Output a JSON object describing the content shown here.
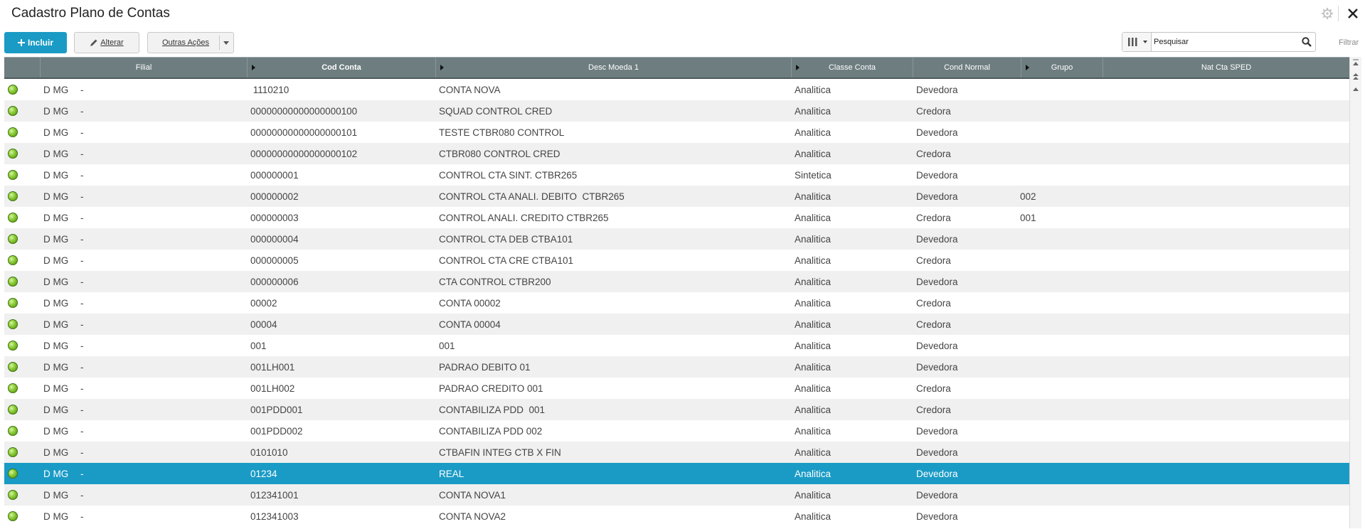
{
  "window": {
    "title": "Cadastro Plano de Contas"
  },
  "toolbar": {
    "incluir_label": "Incluir",
    "alterar_label": "Alterar",
    "outras_label": "Outras Ações"
  },
  "search": {
    "placeholder": "Pesquisar",
    "filter_label": "Filtrar"
  },
  "icons": {
    "gear": "gear-icon",
    "close": "close-icon",
    "plus": "plus-icon",
    "pencil": "pencil-icon",
    "columns": "columns-icon",
    "search": "search-icon",
    "status": "status-dot-icon"
  },
  "colors": {
    "accent": "#1a9bc5",
    "header": "#6e7d80",
    "status_green": "#88c934"
  },
  "grid": {
    "headers": [
      "Filial",
      "Cod Conta",
      "Desc Moeda 1",
      "Classe Conta",
      "Cond Normal",
      "Grupo",
      "Nat Cta SPED"
    ],
    "selected_row": 18,
    "rows": [
      {
        "filial": "D MG",
        "sep": "-",
        "cod": " 1110210",
        "desc": "CONTA NOVA",
        "classe": "Analitica",
        "cond": "Devedora",
        "grupo": "",
        "nat": ""
      },
      {
        "filial": "D MG",
        "sep": "-",
        "cod": "00000000000000000100",
        "desc": "SQUAD CONTROL CRED",
        "classe": "Analitica",
        "cond": "Credora",
        "grupo": "",
        "nat": ""
      },
      {
        "filial": "D MG",
        "sep": "-",
        "cod": "00000000000000000101",
        "desc": "TESTE CTBR080 CONTROL",
        "classe": "Analitica",
        "cond": "Devedora",
        "grupo": "",
        "nat": ""
      },
      {
        "filial": "D MG",
        "sep": "-",
        "cod": "00000000000000000102",
        "desc": "CTBR080 CONTROL CRED",
        "classe": "Analitica",
        "cond": "Credora",
        "grupo": "",
        "nat": ""
      },
      {
        "filial": "D MG",
        "sep": "-",
        "cod": "000000001",
        "desc": "CONTROL CTA SINT. CTBR265",
        "classe": "Sintetica",
        "cond": "Devedora",
        "grupo": "",
        "nat": ""
      },
      {
        "filial": "D MG",
        "sep": "-",
        "cod": "000000002",
        "desc": "CONTROL CTA ANALI. DEBITO  CTBR265",
        "classe": "Analitica",
        "cond": "Devedora",
        "grupo": "002",
        "nat": ""
      },
      {
        "filial": "D MG",
        "sep": "-",
        "cod": "000000003",
        "desc": "CONTROL ANALI. CREDITO CTBR265",
        "classe": "Analitica",
        "cond": "Credora",
        "grupo": "001",
        "nat": ""
      },
      {
        "filial": "D MG",
        "sep": "-",
        "cod": "000000004",
        "desc": "CONTROL CTA DEB CTBA101",
        "classe": "Analitica",
        "cond": "Devedora",
        "grupo": "",
        "nat": ""
      },
      {
        "filial": "D MG",
        "sep": "-",
        "cod": "000000005",
        "desc": "CONTROL CTA CRE CTBA101",
        "classe": "Analitica",
        "cond": "Credora",
        "grupo": "",
        "nat": ""
      },
      {
        "filial": "D MG",
        "sep": "-",
        "cod": "000000006",
        "desc": "CTA CONTROL CTBR200",
        "classe": "Analitica",
        "cond": "Devedora",
        "grupo": "",
        "nat": ""
      },
      {
        "filial": "D MG",
        "sep": "-",
        "cod": "00002",
        "desc": "CONTA 00002",
        "classe": "Analitica",
        "cond": "Credora",
        "grupo": "",
        "nat": ""
      },
      {
        "filial": "D MG",
        "sep": "-",
        "cod": "00004",
        "desc": "CONTA 00004",
        "classe": "Analitica",
        "cond": "Credora",
        "grupo": "",
        "nat": ""
      },
      {
        "filial": "D MG",
        "sep": "-",
        "cod": "001",
        "desc": "001",
        "classe": "Analitica",
        "cond": "Devedora",
        "grupo": "",
        "nat": ""
      },
      {
        "filial": "D MG",
        "sep": "-",
        "cod": "001LH001",
        "desc": "PADRAO DEBITO 01",
        "classe": "Analitica",
        "cond": "Devedora",
        "grupo": "",
        "nat": ""
      },
      {
        "filial": "D MG",
        "sep": "-",
        "cod": "001LH002",
        "desc": "PADRAO CREDITO 001",
        "classe": "Analitica",
        "cond": "Credora",
        "grupo": "",
        "nat": ""
      },
      {
        "filial": "D MG",
        "sep": "-",
        "cod": "001PDD001",
        "desc": "CONTABILIZA PDD  001",
        "classe": "Analitica",
        "cond": "Credora",
        "grupo": "",
        "nat": ""
      },
      {
        "filial": "D MG",
        "sep": "-",
        "cod": "001PDD002",
        "desc": "CONTABILIZA PDD 002",
        "classe": "Analitica",
        "cond": "Devedora",
        "grupo": "",
        "nat": ""
      },
      {
        "filial": "D MG",
        "sep": "-",
        "cod": "0101010",
        "desc": "CTBAFIN INTEG CTB X FIN",
        "classe": "Analitica",
        "cond": "Devedora",
        "grupo": "",
        "nat": ""
      },
      {
        "filial": "D MG",
        "sep": "-",
        "cod": "01234",
        "desc": "REAL",
        "classe": "Analitica",
        "cond": "Devedora",
        "grupo": "",
        "nat": ""
      },
      {
        "filial": "D MG",
        "sep": "-",
        "cod": "012341001",
        "desc": "CONTA NOVA1",
        "classe": "Analitica",
        "cond": "Devedora",
        "grupo": "",
        "nat": ""
      },
      {
        "filial": "D MG",
        "sep": "-",
        "cod": "012341003",
        "desc": "CONTA NOVA2",
        "classe": "Analitica",
        "cond": "Devedora",
        "grupo": "",
        "nat": ""
      }
    ]
  }
}
